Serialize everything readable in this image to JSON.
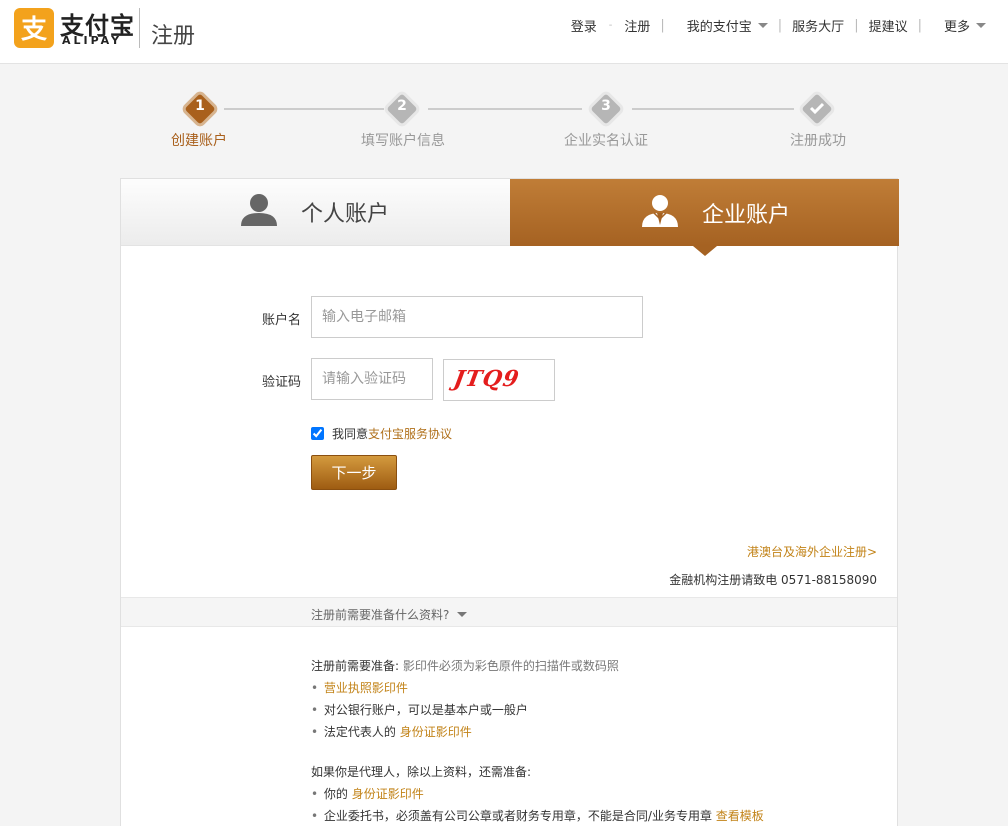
{
  "header": {
    "brand_cn": "支付宝",
    "brand_en": "ALIPAY",
    "page": "注册",
    "nav": {
      "login": "登录",
      "register": "注册",
      "my_alipay": "我的支付宝",
      "service_hall": "服务大厅",
      "suggest": "提建议",
      "more": "更多"
    }
  },
  "steps": [
    {
      "num": "1",
      "label": "创建账户",
      "state": "active"
    },
    {
      "num": "2",
      "label": "填写账户信息",
      "state": "pending"
    },
    {
      "num": "3",
      "label": "企业实名认证",
      "state": "pending"
    },
    {
      "num": "",
      "label": "注册成功",
      "state": "pending",
      "icon": "check-icon"
    }
  ],
  "tabs": {
    "personal": "个人账户",
    "enterprise": "企业账户",
    "selected": "enterprise"
  },
  "form": {
    "account_label": "账户名",
    "account_placeholder": "输入电子邮箱",
    "captcha_label": "验证码",
    "captcha_placeholder": "请输入验证码",
    "captcha_text": "JTQ9",
    "agree_prefix": "我同意",
    "agree_link": "支付宝服务协议",
    "agree_checked": true,
    "next_button": "下一步"
  },
  "links": {
    "hk_register": "港澳台及海外企业注册>",
    "finance_tel": "金融机构注册请致电  0571-88158090"
  },
  "prep": {
    "toggle": "注册前需要准备什么资料?",
    "title": "注册前需要准备:",
    "note": "影印件必须为彩色原件的扫描件或数码照",
    "items": [
      {
        "prefix": "",
        "link": "营业执照影印件",
        "suffix": ""
      },
      {
        "prefix": "对公银行账户，可以是基本户或一般户",
        "link": "",
        "suffix": ""
      },
      {
        "prefix": "法定代表人的",
        "link": "身份证影印件",
        "suffix": ""
      }
    ],
    "agent_title": "如果你是代理人，除以上资料，还需准备:",
    "agent_items": [
      {
        "prefix": "你的",
        "link": "身份证影印件",
        "suffix": ""
      },
      {
        "prefix": "企业委托书，必须盖有公司公章或者财务专用章，不能是合同/业务专用章 ",
        "link": "查看模板",
        "suffix": ""
      }
    ]
  },
  "colors": {
    "brand": "#f3a21c",
    "accent": "#a9601c",
    "link": "#c28318"
  }
}
